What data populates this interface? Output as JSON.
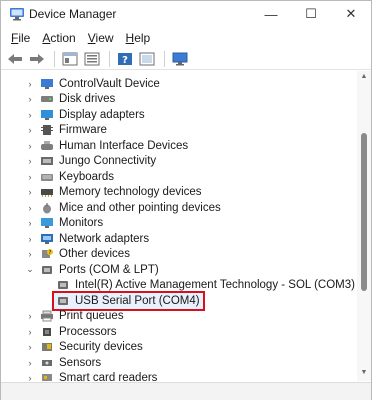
{
  "window": {
    "title": "Device Manager"
  },
  "menu": {
    "file": {
      "u": "F",
      "rest": "ile"
    },
    "action": {
      "u": "A",
      "rest": "ction"
    },
    "view": {
      "u": "V",
      "rest": "iew"
    },
    "help": {
      "u": "H",
      "rest": "elp"
    }
  },
  "toolbar": {
    "icons": [
      "back-icon",
      "forward-icon",
      "properties-pane-icon",
      "list-view-icon",
      "help-icon",
      "device-view-icon",
      "monitor-icon"
    ]
  },
  "tree": {
    "items": [
      {
        "label": "ControlVault Device",
        "icon": "controlvault-icon"
      },
      {
        "label": "Disk drives",
        "icon": "disk-drive-icon"
      },
      {
        "label": "Display adapters",
        "icon": "display-adapter-icon"
      },
      {
        "label": "Firmware",
        "icon": "firmware-icon"
      },
      {
        "label": "Human Interface Devices",
        "icon": "hid-icon"
      },
      {
        "label": "Jungo Connectivity",
        "icon": "jungo-icon"
      },
      {
        "label": "Keyboards",
        "icon": "keyboard-icon"
      },
      {
        "label": "Memory technology devices",
        "icon": "memory-icon"
      },
      {
        "label": "Mice and other pointing devices",
        "icon": "mouse-icon"
      },
      {
        "label": "Monitors",
        "icon": "monitor-icon"
      },
      {
        "label": "Network adapters",
        "icon": "network-adapter-icon"
      },
      {
        "label": "Other devices",
        "icon": "other-devices-icon"
      },
      {
        "label": "Ports (COM & LPT)",
        "icon": "port-icon"
      },
      {
        "label": "Intel(R) Active Management Technology - SOL (COM3)",
        "icon": "port-icon"
      },
      {
        "label": "USB Serial Port (COM4)",
        "icon": "port-icon"
      },
      {
        "label": "Print queues",
        "icon": "printer-icon"
      },
      {
        "label": "Processors",
        "icon": "processor-icon"
      },
      {
        "label": "Security devices",
        "icon": "security-icon"
      },
      {
        "label": "Sensors",
        "icon": "sensor-icon"
      },
      {
        "label": "Smart card readers",
        "icon": "smart-card-icon"
      }
    ],
    "selected": "USB Serial Port (COM4)",
    "highlight_color": "#d6101c"
  }
}
